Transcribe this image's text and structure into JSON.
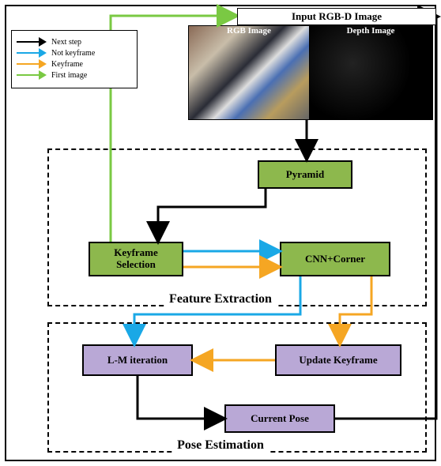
{
  "title": "Input RGB-D Image",
  "img_labels": {
    "rgb": "RGB Image",
    "depth": "Depth Image"
  },
  "legend": [
    {
      "label": "Next step",
      "color": "#000000"
    },
    {
      "label": "Not keyframe",
      "color": "#1aa8e6"
    },
    {
      "label": "Keyframe",
      "color": "#f5a623"
    },
    {
      "label": "First image",
      "color": "#7ac943"
    }
  ],
  "groups": {
    "feature_extraction": "Feature Extraction",
    "pose_estimation": "Pose Estimation"
  },
  "nodes": {
    "pyramid": "Pyramid",
    "keyframe_selection": "Keyframe\nSelection",
    "cnn_corner": "CNN+Corner",
    "lm_iteration": "L-M iteration",
    "update_keyframe": "Update Keyframe",
    "current_pose": "Current Pose"
  },
  "arrow_colors": {
    "next": "#000000",
    "not_keyframe": "#1aa8e6",
    "keyframe": "#f5a623",
    "first": "#7ac943"
  },
  "chart_data": {
    "type": "flowchart",
    "nodes": [
      {
        "id": "input",
        "label": "Input RGB-D Image",
        "group": null
      },
      {
        "id": "pyramid",
        "label": "Pyramid",
        "group": "Feature Extraction"
      },
      {
        "id": "keysel",
        "label": "Keyframe Selection",
        "group": "Feature Extraction"
      },
      {
        "id": "cnn",
        "label": "CNN+Corner",
        "group": "Feature Extraction"
      },
      {
        "id": "lm",
        "label": "L-M iteration",
        "group": "Pose Estimation"
      },
      {
        "id": "upkf",
        "label": "Update Keyframe",
        "group": "Pose Estimation"
      },
      {
        "id": "curpose",
        "label": "Current Pose",
        "group": "Pose Estimation"
      }
    ],
    "edges": [
      {
        "from": "input",
        "to": "pyramid",
        "kind": "next"
      },
      {
        "from": "pyramid",
        "to": "keysel",
        "kind": "next"
      },
      {
        "from": "keysel",
        "to": "cnn",
        "kind": "not_keyframe"
      },
      {
        "from": "keysel",
        "to": "cnn",
        "kind": "keyframe"
      },
      {
        "from": "keysel",
        "to": "input",
        "kind": "first"
      },
      {
        "from": "cnn",
        "to": "lm",
        "kind": "not_keyframe"
      },
      {
        "from": "cnn",
        "to": "upkf",
        "kind": "keyframe"
      },
      {
        "from": "upkf",
        "to": "lm",
        "kind": "keyframe"
      },
      {
        "from": "lm",
        "to": "curpose",
        "kind": "next"
      },
      {
        "from": "curpose",
        "to": "input",
        "kind": "next"
      }
    ],
    "legend": {
      "next": "Next step",
      "not_keyframe": "Not keyframe",
      "keyframe": "Keyframe",
      "first": "First image"
    }
  }
}
